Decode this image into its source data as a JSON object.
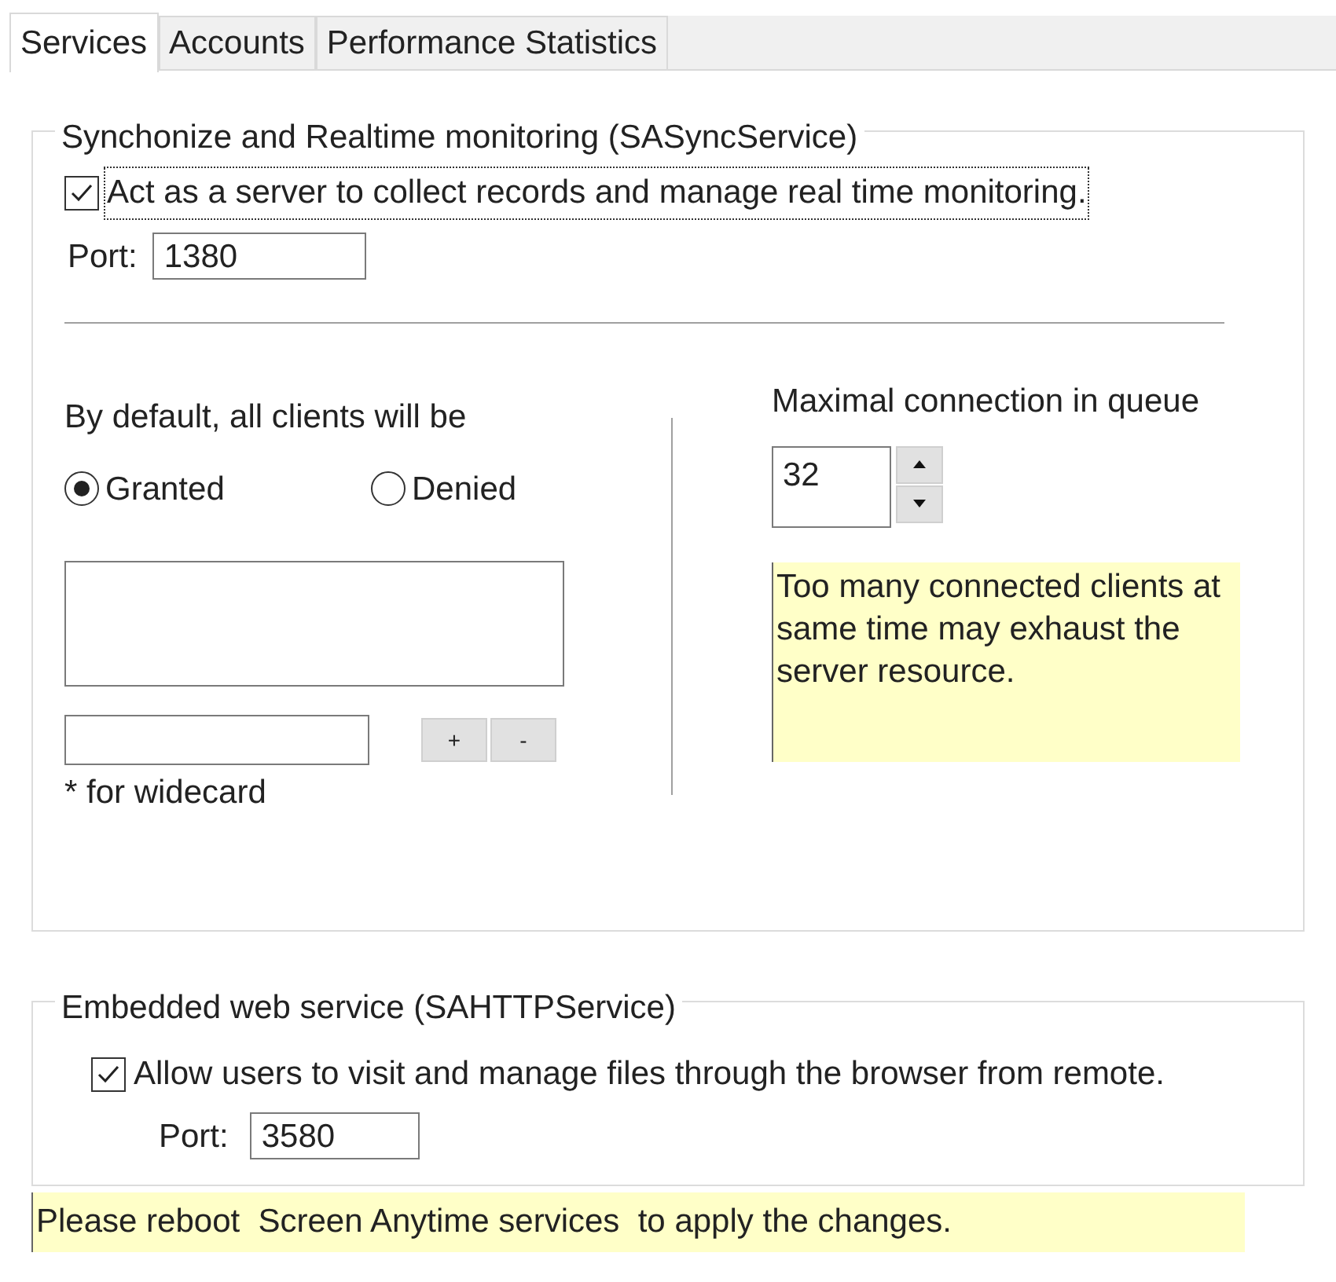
{
  "tabs": [
    {
      "label": "Services",
      "selected": true
    },
    {
      "label": "Accounts",
      "selected": false
    },
    {
      "label": "Performance Statistics",
      "selected": false
    }
  ],
  "sync_group": {
    "title": "Synchonize and Realtime monitoring (SASyncService)",
    "server_checkbox": {
      "label": "Act as a server to collect records and manage real time monitoring.",
      "checked": true
    },
    "port_label": "Port:",
    "port_value": "1380",
    "default_label": "By default, all clients will be",
    "radios": [
      {
        "label": "Granted",
        "selected": true
      },
      {
        "label": "Denied",
        "selected": false
      }
    ],
    "add_button": "+",
    "remove_button": "-",
    "wildcard_hint": "* for widecard",
    "queue_label": "Maximal connection in queue",
    "queue_value": "32",
    "queue_note": "Too many connected clients at same time may exhaust the server resource."
  },
  "web_group": {
    "title": "Embedded web service (SAHTTPService)",
    "allow_checkbox": {
      "label": "Allow users to visit and manage files through the browser from remote.",
      "checked": true
    },
    "port_label": "Port:",
    "port_value": "3580"
  },
  "notice": "Please reboot  Screen Anytime services  to apply the changes."
}
